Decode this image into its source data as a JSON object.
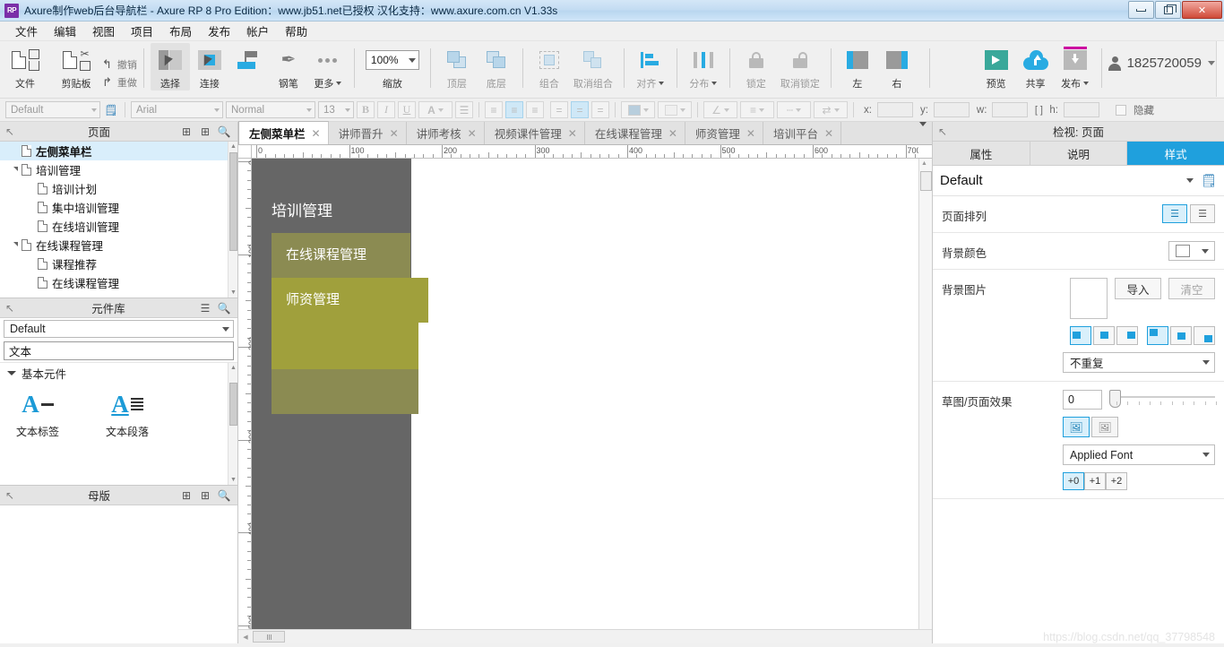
{
  "window": {
    "title": "Axure制作web后台导航栏 - Axure RP 8 Pro Edition：www.jb51.net已授权 汉化支持：www.axure.com.cn V1.33s",
    "logo": "RP",
    "minimize": "minimize-icon",
    "maximize": "restore-icon",
    "close": "✕"
  },
  "menu": [
    "文件",
    "编辑",
    "视图",
    "项目",
    "布局",
    "发布",
    "帐户",
    "帮助"
  ],
  "toolbar": {
    "file": "文件",
    "clipboard": "剪贴板",
    "undo": "撤销",
    "redo": "重做",
    "select": "选择",
    "connect": "连接",
    "pen": "钢笔",
    "more": "更多",
    "zoom_value": "100%",
    "zoom_label": "缩放",
    "front": "顶层",
    "back": "底层",
    "group": "组合",
    "ungroup": "取消组合",
    "align": "对齐",
    "distribute": "分布",
    "lock": "锁定",
    "unlock": "取消锁定",
    "left": "左",
    "right": "右",
    "preview": "预览",
    "share": "共享",
    "publish": "发布",
    "account_name": "1825720059"
  },
  "format_bar": {
    "style_preset": "Default",
    "font_family": "Arial",
    "font_weight": "Normal",
    "font_size": "13",
    "bold": "B",
    "italic": "I",
    "underline": "U",
    "font_color": "A",
    "x_label": "x:",
    "y_label": "y:",
    "w_label": "w:",
    "h_label": "h:",
    "x_value": "",
    "y_value": "",
    "w_value": "",
    "h_value": "",
    "hidden_label": "隐藏"
  },
  "pages_panel": {
    "title": "页面",
    "tree": [
      {
        "label": "左侧菜单栏",
        "depth": 0,
        "selected": true,
        "expandable": false
      },
      {
        "label": "培训管理",
        "depth": 0,
        "selected": false,
        "expandable": true
      },
      {
        "label": "培训计划",
        "depth": 1,
        "selected": false,
        "expandable": false
      },
      {
        "label": "集中培训管理",
        "depth": 1,
        "selected": false,
        "expandable": false
      },
      {
        "label": "在线培训管理",
        "depth": 1,
        "selected": false,
        "expandable": false
      },
      {
        "label": "在线课程管理",
        "depth": 0,
        "selected": false,
        "expandable": true
      },
      {
        "label": "课程推荐",
        "depth": 1,
        "selected": false,
        "expandable": false
      },
      {
        "label": "在线课程管理",
        "depth": 1,
        "selected": false,
        "expandable": false
      }
    ]
  },
  "library_panel": {
    "title": "元件库",
    "selected_library": "Default",
    "search_value": "文本",
    "category": "基本元件",
    "widgets": [
      {
        "label": "文本标签",
        "icon": "text-label-icon"
      },
      {
        "label": "文本段落",
        "icon": "text-paragraph-icon"
      }
    ]
  },
  "masters_panel": {
    "title": "母版"
  },
  "tabs": [
    {
      "label": "左侧菜单栏",
      "active": true
    },
    {
      "label": "讲师晋升",
      "active": false
    },
    {
      "label": "讲师考核",
      "active": false
    },
    {
      "label": "视频课件管理",
      "active": false
    },
    {
      "label": "在线课程管理",
      "active": false
    },
    {
      "label": "师资管理",
      "active": false
    },
    {
      "label": "培训平台",
      "active": false
    }
  ],
  "canvas": {
    "ruler_h_labels": [
      "0",
      "100",
      "200",
      "300",
      "400",
      "500",
      "600",
      "700"
    ],
    "ruler_v_labels": [
      "0",
      "100",
      "200",
      "300",
      "400",
      "500"
    ],
    "mock": {
      "title": "培训管理",
      "items": [
        {
          "label": "在线课程管理",
          "color": "#8b8b52"
        },
        {
          "label": "师资管理",
          "color": "#a0a03c"
        },
        {
          "label": "",
          "color": "#a0a03c"
        },
        {
          "label": "",
          "color": "#8b8b52"
        }
      ],
      "sidebar_color": "#666666"
    },
    "watermark": "https://blog.csdn.net/qq_37798548"
  },
  "inspector": {
    "title": "检视: 页面",
    "tabs": [
      {
        "label": "属性",
        "active": false
      },
      {
        "label": "说明",
        "active": false
      },
      {
        "label": "样式",
        "active": true
      }
    ],
    "style_name": "Default",
    "rows": {
      "page_align_label": "页面排列",
      "bg_color_label": "背景颜色",
      "bg_image_label": "背景图片",
      "import_btn": "导入",
      "clear_btn": "清空",
      "repeat_value": "不重复",
      "sketch_label": "草图/页面效果",
      "sketch_value": "0",
      "font_value": "Applied Font",
      "font_steps": [
        "+0",
        "+1",
        "+2"
      ]
    }
  }
}
